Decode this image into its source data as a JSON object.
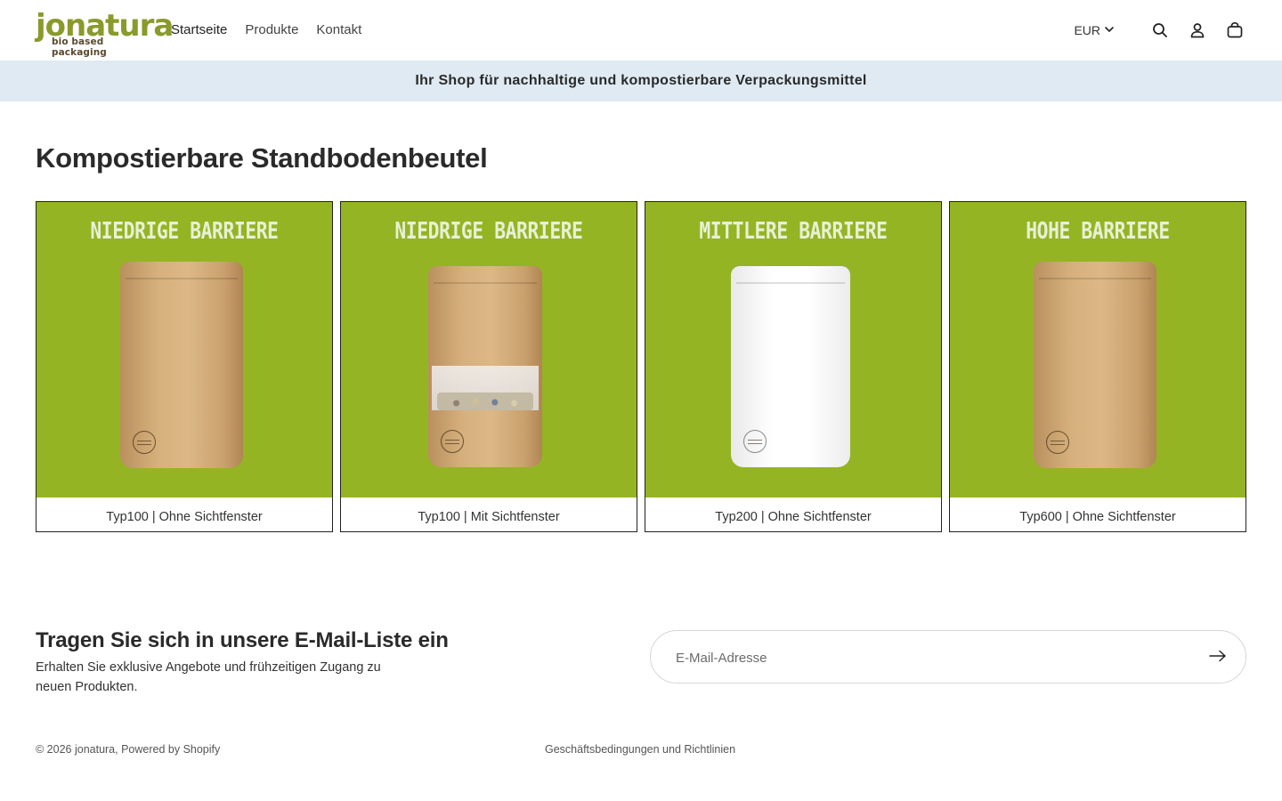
{
  "header": {
    "logo": {
      "word": "jonatura",
      "tagline": "bio based packaging"
    },
    "nav": [
      {
        "label": "Startseite"
      },
      {
        "label": "Produkte"
      },
      {
        "label": "Kontakt"
      }
    ],
    "currency": "EUR",
    "icons": [
      "search-icon",
      "account-icon",
      "cart-icon"
    ]
  },
  "announcement": {
    "text": "Ihr Shop für nachhaltige und kompostierbare Verpackungsmittel"
  },
  "collection": {
    "title": "Kompostierbare Standbodenbeutel",
    "products": [
      {
        "badge": "NIEDRIGE BARRIERE",
        "caption": "Typ100 | Ohne Sichtfenster",
        "pouch": "kraft"
      },
      {
        "badge": "NIEDRIGE BARRIERE",
        "caption": "Typ100 | Mit Sichtfenster",
        "pouch": "kraft-window"
      },
      {
        "badge": "MITTLERE BARRIERE",
        "caption": "Typ200 | Ohne Sichtfenster",
        "pouch": "white"
      },
      {
        "badge": "HOHE BARRIERE",
        "caption": "Typ600 | Ohne Sichtfenster",
        "pouch": "kraft"
      }
    ]
  },
  "newsletter": {
    "title": "Tragen Sie sich in unsere E-Mail-Liste ein",
    "text": "Erhalten Sie exklusive Angebote und frühzeitigen Zugang zu neuen Produkten.",
    "placeholder": "E-Mail-Adresse",
    "value": ""
  },
  "footer": {
    "copyright": "© 2026 jonatura, Powered by Shopify",
    "policy_link": "Geschäftsbedingungen und Richtlinien"
  },
  "colors": {
    "brand_green": "#8a9a2b",
    "product_bg": "#95b424",
    "announcement_bg": "#dfeaf3"
  }
}
